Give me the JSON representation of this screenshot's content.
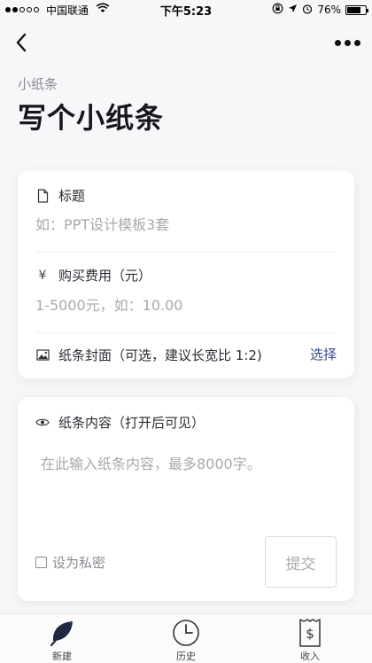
{
  "status_bar": {
    "carrier": "中国联通",
    "time": "下午5:23",
    "battery_percent": "76%",
    "battery_level": 0.76
  },
  "nav": {
    "back_icon": "chevron-left-icon",
    "more_icon": "more-dots-icon"
  },
  "header": {
    "subtitle": "小纸条",
    "title": "写个小纸条"
  },
  "form": {
    "title_label": "标题",
    "title_placeholder": "如：PPT设计模板3套",
    "price_label": "购买费用（元）",
    "price_placeholder": "1-5000元，如：10.00",
    "cover_label": "纸条封面（可选，建议长宽比 1:2)",
    "cover_action": "选择",
    "content_label": "纸条内容（打开后可见）",
    "content_placeholder": "在此输入纸条内容，最多8000字。",
    "private_label": "设为私密",
    "submit_label": "提交"
  },
  "tabs": [
    {
      "label": "新建",
      "icon": "leaf-icon",
      "active": true
    },
    {
      "label": "历史",
      "icon": "clock-icon",
      "active": false
    },
    {
      "label": "收入",
      "icon": "receipt-icon",
      "active": false
    }
  ],
  "colors": {
    "accent": "#3a4a8e",
    "tab_icon_active": "#1e2a44"
  }
}
